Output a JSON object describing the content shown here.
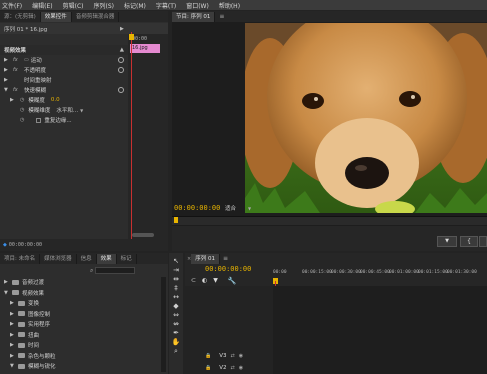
{
  "menu": [
    "文件(F)",
    "编辑(E)",
    "剪辑(C)",
    "序列(S)",
    "标记(M)",
    "字幕(T)",
    "窗口(W)",
    "帮助(H)"
  ],
  "source_panel": {
    "tabs": [
      "源：(无剪辑)",
      "效果控件",
      "音频剪辑混合器"
    ],
    "active_tab": 1,
    "header": "序列 01 * 16.jpg",
    "mini_timecode": "00:00",
    "clip_label": "16.jpg",
    "section_title": "视频效果",
    "rows": [
      {
        "label": "运动",
        "prefix": "fx",
        "icon": "motion-icon"
      },
      {
        "label": "不透明度",
        "prefix": "fx"
      },
      {
        "label": "时间重映射",
        "prefix": ""
      },
      {
        "label": "快速模糊",
        "prefix": "fx"
      }
    ],
    "sub_rows": [
      {
        "label": "模糊度",
        "value": "0.0"
      },
      {
        "label": "模糊维度",
        "value": "水平和..."
      },
      {
        "label": "重复边缘...",
        "value": ""
      }
    ],
    "bottom_timecode": "00:00:00:00"
  },
  "program_monitor": {
    "tabs": [
      "节目: 序列 01"
    ],
    "timecode": "00:00:00:00",
    "fit": "适合",
    "fit_arrow": "▼"
  },
  "project_panel": {
    "tabs": [
      "项目: 未命名",
      "媒体浏览器",
      "信息",
      "效果",
      "标记"
    ],
    "active_tab": 3,
    "search_placeholder": "",
    "items": [
      {
        "label": "音频过渡",
        "indent": 0
      },
      {
        "label": "视频效果",
        "indent": 0
      },
      {
        "label": "变换",
        "indent": 1
      },
      {
        "label": "图像控制",
        "indent": 1
      },
      {
        "label": "实用程序",
        "indent": 1
      },
      {
        "label": "扭曲",
        "indent": 1
      },
      {
        "label": "时间",
        "indent": 1
      },
      {
        "label": "杂色与颗粒",
        "indent": 1
      },
      {
        "label": "模糊与锐化",
        "indent": 1
      }
    ]
  },
  "timeline": {
    "tabs": [
      "序列 01"
    ],
    "timecode": "00:00:00:00",
    "ruler": [
      "00:00",
      "00:00:15:00",
      "00:00:30:00",
      "00:00:45:00",
      "00:01:00:00",
      "00:01:15:00",
      "00:01:30:00"
    ],
    "tracks": [
      "V3",
      "V2"
    ]
  },
  "colors": {
    "accent": "#e8b400",
    "playhead": "#c83030",
    "clip_pink": "#e58ad0",
    "panel": "#2d2d2d",
    "dark": "#1e1e1e"
  }
}
